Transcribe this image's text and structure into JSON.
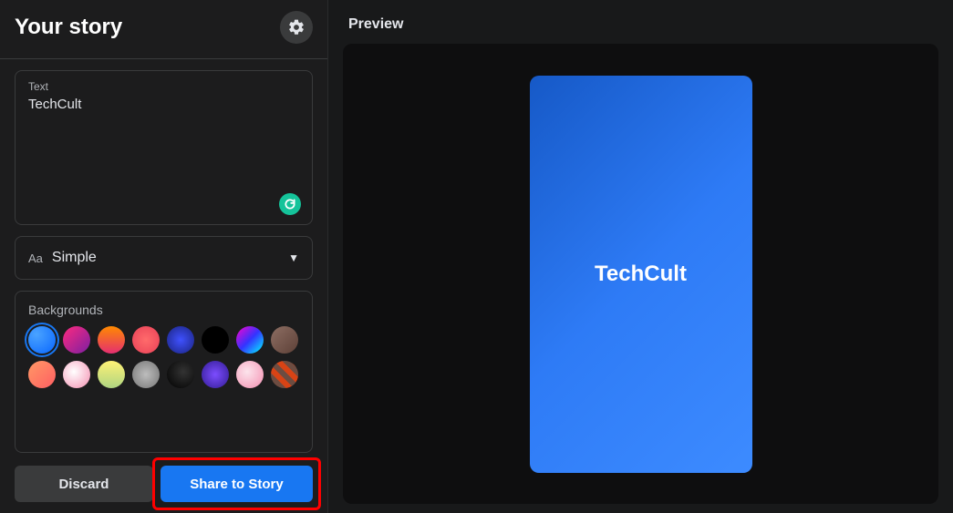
{
  "sidebar": {
    "title": "Your story",
    "text_field": {
      "label": "Text",
      "value": "TechCult"
    },
    "font_selector": {
      "prefix": "Aa",
      "selected": "Simple"
    },
    "backgrounds": {
      "title": "Backgrounds",
      "swatches": [
        {
          "id": "bg-blue",
          "style": "radial-gradient(circle at 30% 30%, #4aa3ff, #0866ff)",
          "selected": true
        },
        {
          "id": "bg-magenta",
          "style": "linear-gradient(135deg,#ff2a7f,#7b1fa2)"
        },
        {
          "id": "bg-sunset",
          "style": "linear-gradient(180deg,#ff8a00,#e52e71)"
        },
        {
          "id": "bg-coral",
          "style": "radial-gradient(circle,#ff6b6b,#e94057)"
        },
        {
          "id": "bg-royal",
          "style": "radial-gradient(circle,#3f51ff,#1a237e)"
        },
        {
          "id": "bg-black",
          "style": "#000000"
        },
        {
          "id": "bg-rainbow",
          "style": "linear-gradient(135deg,#ff00cc,#3333ff,#00ffff)"
        },
        {
          "id": "bg-rust",
          "style": "linear-gradient(135deg,#8d6e63,#5d4037)"
        },
        {
          "id": "bg-orange",
          "style": "linear-gradient(135deg,#ff9966,#ff5e62)"
        },
        {
          "id": "bg-cloud",
          "style": "radial-gradient(circle at 40% 40%,#fff,#f48fb1)"
        },
        {
          "id": "bg-yellow",
          "style": "linear-gradient(180deg,#fff176,#aed581)"
        },
        {
          "id": "bg-grey",
          "style": "radial-gradient(circle,#bdbdbd,#757575)"
        },
        {
          "id": "bg-eclipse",
          "style": "radial-gradient(circle at 60% 40%,#333,#000)"
        },
        {
          "id": "bg-purple",
          "style": "radial-gradient(circle,#7c4dff,#311b92)"
        },
        {
          "id": "bg-pink",
          "style": "radial-gradient(circle at 40% 40%,#fce4ec,#f48fb1)"
        },
        {
          "id": "bg-stripes",
          "style": "repeating-linear-gradient(45deg,#d84315 0 6px,#6d4c41 6px 12px)"
        }
      ]
    }
  },
  "actions": {
    "discard": "Discard",
    "share": "Share to Story"
  },
  "preview": {
    "title": "Preview",
    "story_text": "TechCult"
  },
  "colors": {
    "primary": "#1877f2"
  }
}
